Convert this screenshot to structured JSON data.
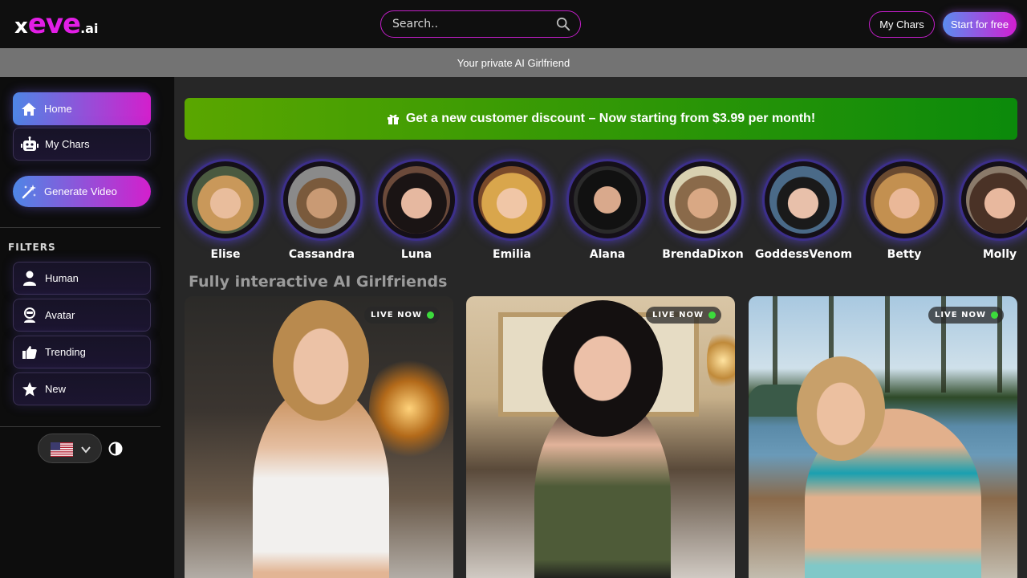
{
  "header": {
    "logo": {
      "part1": "x",
      "part2": "eve",
      "part3": ".ai"
    },
    "search_placeholder": "Search..",
    "my_chars_label": "My Chars",
    "start_label": "Start for free"
  },
  "subbar_text": "Your private AI Girlfriend",
  "sidebar": {
    "nav": [
      {
        "label": "Home",
        "icon": "home-icon"
      },
      {
        "label": "My Chars",
        "icon": "robot-icon"
      },
      {
        "label": "Generate Video",
        "icon": "magic-wand-icon"
      }
    ],
    "filters_label": "FILTERS",
    "filters": [
      {
        "label": "Human",
        "icon": "person-icon"
      },
      {
        "label": "Avatar",
        "icon": "avatar-icon"
      },
      {
        "label": "Trending",
        "icon": "thumbs-up-icon"
      },
      {
        "label": "New",
        "icon": "star-icon"
      }
    ],
    "language_flag": "us-flag-icon"
  },
  "promo_text": "Get a new customer discount – Now starting from $3.99 per month!",
  "stories": [
    {
      "name": "Elise"
    },
    {
      "name": "Cassandra"
    },
    {
      "name": "Luna"
    },
    {
      "name": "Emilia"
    },
    {
      "name": "Alana"
    },
    {
      "name": "BrendaDixon"
    },
    {
      "name": "GoddessVenom"
    },
    {
      "name": "Betty"
    },
    {
      "name": "Molly"
    }
  ],
  "section_title": "Fully interactive AI Girlfriends",
  "cards": [
    {
      "badge": "LIVE NOW"
    },
    {
      "badge": "LIVE NOW"
    },
    {
      "badge": "LIVE NOW"
    }
  ],
  "colors": {
    "accent": "#e21ee6",
    "promo": "#5aa600",
    "live": "#3cdb3c"
  }
}
